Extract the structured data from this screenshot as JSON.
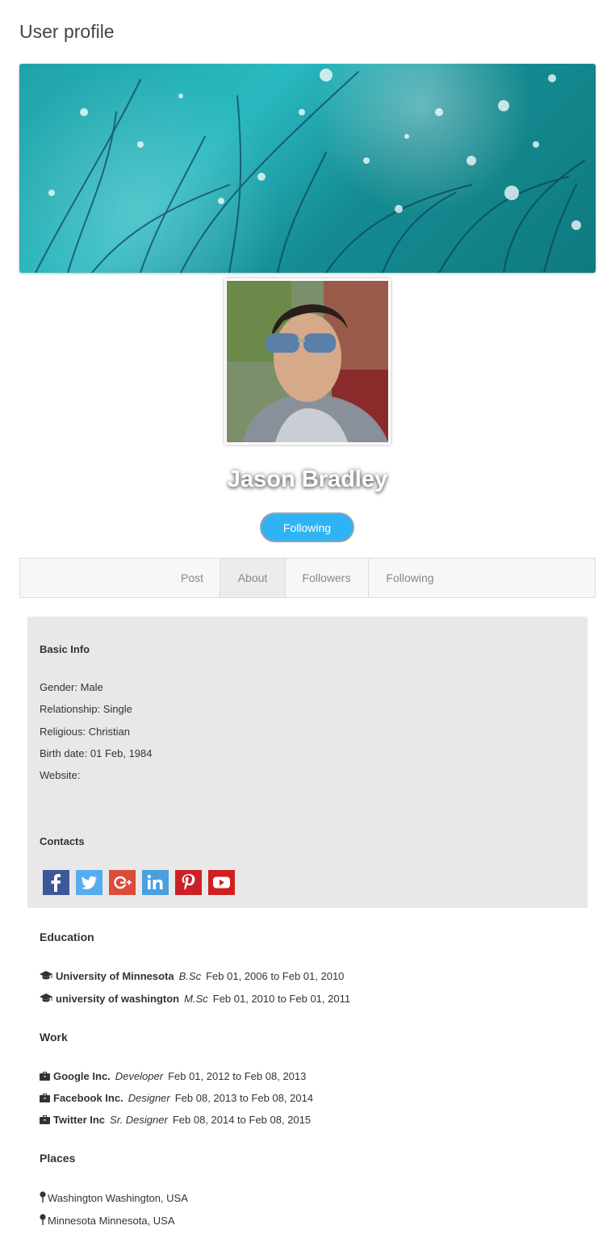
{
  "page": {
    "title": "User profile"
  },
  "profile": {
    "name": "Jason Bradley",
    "follow_button": "Following"
  },
  "tabs": [
    {
      "label": "Post"
    },
    {
      "label": "About",
      "active": true
    },
    {
      "label": "Followers"
    },
    {
      "label": "Following"
    }
  ],
  "basic_info": {
    "title": "Basic Info",
    "gender": "Gender: Male",
    "relationship": "Relationship: Single",
    "religious": "Religious: Christian",
    "birth_date": "Birth date: 01 Feb, 1984",
    "website": "Website:"
  },
  "contacts": {
    "title": "Contacts",
    "icons": [
      {
        "name": "facebook-icon",
        "color": "#3b5998"
      },
      {
        "name": "twitter-icon",
        "color": "#55acee"
      },
      {
        "name": "google-plus-icon",
        "color": "#dd4b39"
      },
      {
        "name": "linkedin-icon",
        "color": "#4a9fdf"
      },
      {
        "name": "pinterest-icon",
        "color": "#cb2027"
      },
      {
        "name": "youtube-icon",
        "color": "#cd201f"
      }
    ]
  },
  "education": {
    "title": "Education",
    "items": [
      {
        "school": "University of Minnesota",
        "degree": "B.Sc",
        "period": "Feb 01, 2006 to Feb 01, 2010",
        "icon": "graduation-cap-icon"
      },
      {
        "school": "university of washington",
        "degree": "M.Sc",
        "period": "Feb 01, 2010 to Feb 01, 2011",
        "icon": "graduation-cap-icon"
      }
    ]
  },
  "work": {
    "title": "Work",
    "items": [
      {
        "company": "Google Inc.",
        "role": "Developer",
        "period": "Feb 01, 2012 to Feb 08, 2013",
        "icon": "briefcase-icon"
      },
      {
        "company": "Facebook Inc.",
        "role": "Designer",
        "period": "Feb 08, 2013 to Feb 08, 2014",
        "icon": "briefcase-icon"
      },
      {
        "company": "Twitter Inc",
        "role": "Sr. Designer",
        "period": "Feb 08, 2014 to Feb 08, 2015",
        "icon": "briefcase-icon"
      }
    ]
  },
  "places": {
    "title": "Places",
    "items": [
      {
        "label": "Washington Washington, USA",
        "icon": "map-pin-icon"
      },
      {
        "label": "Minnesota Minnesota, USA",
        "icon": "map-pin-icon"
      }
    ]
  }
}
